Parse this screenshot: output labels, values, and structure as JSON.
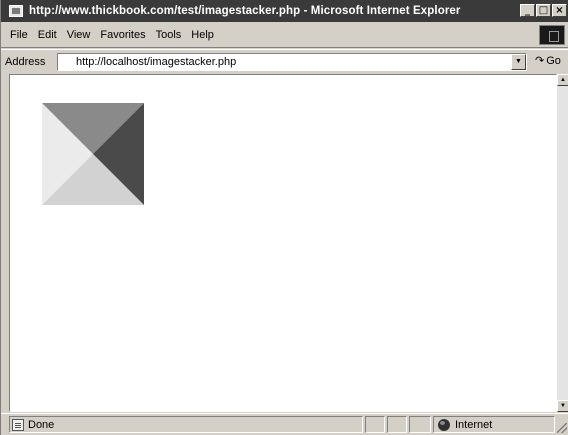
{
  "window": {
    "title": "http://www.thickbook.com/test/imagestacker.php - Microsoft Internet Explorer",
    "controls": {
      "minimize": "_",
      "maximize": "□",
      "close": "×"
    }
  },
  "menubar": {
    "items": [
      "File",
      "Edit",
      "View",
      "Favorites",
      "Tools",
      "Help"
    ]
  },
  "addressbar": {
    "label": "Address",
    "url": "http://localhost/imagestacker.php",
    "go_label": "Go"
  },
  "content": {
    "image": {
      "icon": "stacked-triangles-image",
      "colors": {
        "top": "#8a8a8a",
        "right": "#4a4a4a",
        "bottom": "#d2d2d2",
        "left": "#ebebeb"
      }
    }
  },
  "statusbar": {
    "status": "Done",
    "zone": "Internet"
  }
}
